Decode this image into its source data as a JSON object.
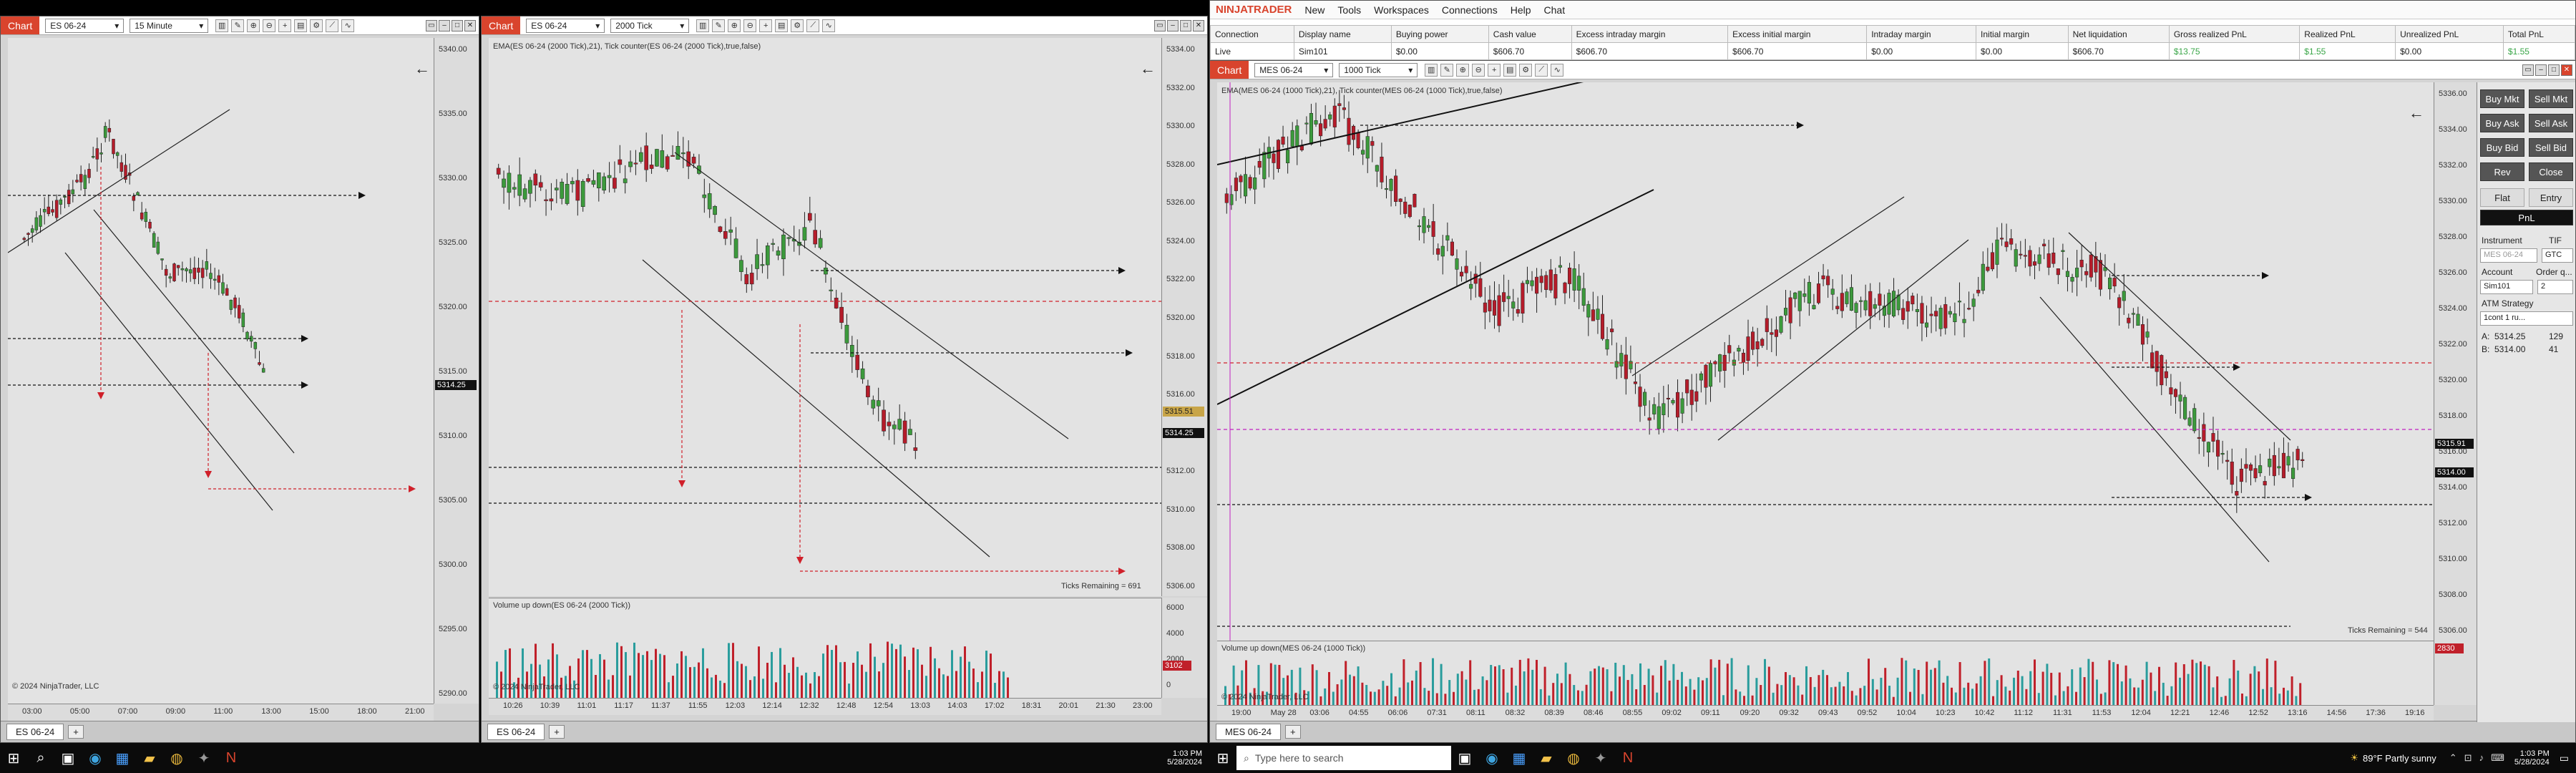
{
  "chart1": {
    "label": "Chart",
    "instrument": "ES 06-24",
    "period": "15 Minute",
    "y_ticks": [
      "5340.00",
      "5335.00",
      "5330.00",
      "5325.00",
      "5320.00",
      "5315.00",
      "5310.00",
      "5305.00",
      "5300.00",
      "5295.00",
      "5290.00"
    ],
    "x_ticks": [
      "03:00",
      "05:00",
      "07:00",
      "09:00",
      "11:00",
      "13:00",
      "15:00",
      "18:00",
      "21:00"
    ],
    "last_price": "5314.25",
    "copyright": "© 2024 NinjaTrader, LLC",
    "tab": "ES 06-24",
    "tab_add": "+",
    "back": "←"
  },
  "chart2": {
    "label": "Chart",
    "instrument": "ES 06-24",
    "period": "2000 Tick",
    "indicator": "EMA(ES 06-24 (2000 Tick),21), Tick counter(ES 06-24 (2000 Tick),true,false)",
    "y_ticks": [
      "5334.00",
      "5332.00",
      "5330.00",
      "5328.00",
      "5326.00",
      "5324.00",
      "5322.00",
      "5320.00",
      "5318.00",
      "5316.00",
      "5314.00",
      "5312.00",
      "5310.00",
      "5308.00",
      "5306.00"
    ],
    "x_ticks": [
      "10:26",
      "10:39",
      "11:01",
      "11:17",
      "11:37",
      "11:55",
      "12:03",
      "12:14",
      "12:32",
      "12:48",
      "12:54",
      "13:03",
      "14:03",
      "17:02",
      "18:31",
      "20:01",
      "21:30",
      "23:00"
    ],
    "price_badge_1": "5315.51",
    "price_badge_2": "5314.25",
    "ticks_remaining": "Ticks Remaining = 691",
    "volume_title": "Volume up down(ES 06-24 (2000 Tick))",
    "volume_ticks": [
      "6000",
      "4000",
      "2000",
      "0"
    ],
    "volume_badge": "3102",
    "copyright": "© 2024 NinjaTrader, LLC",
    "tab": "ES 06-24",
    "tab_add": "+",
    "back": "←"
  },
  "nt": {
    "brand": "NINJATRADER",
    "menu": [
      "New",
      "Tools",
      "Workspaces",
      "Connections",
      "Help",
      "Chat"
    ],
    "table_headers": [
      "Connection",
      "Display name",
      "Buying power",
      "Cash value",
      "Excess intraday margin",
      "Excess initial margin",
      "Intraday margin",
      "Initial margin",
      "Net liquidation",
      "Gross realized PnL",
      "Realized PnL",
      "Unrealized PnL",
      "Total PnL"
    ],
    "table_row": [
      "Live",
      "Sim101",
      "$0.00",
      "$606.70",
      "$606.70",
      "$606.70",
      "$0.00",
      "$0.00",
      "$606.70",
      "$13.75",
      "$1.55",
      "$0.00",
      "$1.55"
    ]
  },
  "chart3": {
    "label": "Chart",
    "instrument": "MES 06-24",
    "period": "1000 Tick",
    "indicator": "EMA(MES 06-24 (1000 Tick),21), Tick counter(MES 06-24 (1000 Tick),true,false)",
    "y_ticks": [
      "5336.00",
      "5334.00",
      "5332.00",
      "5330.00",
      "5328.00",
      "5326.00",
      "5324.00",
      "5322.00",
      "5320.00",
      "5318.00",
      "5316.00",
      "5314.00",
      "5312.00",
      "5310.00",
      "5308.00",
      "5306.00"
    ],
    "x_ticks": [
      "19:00",
      "May 28",
      "03:06",
      "04:55",
      "06:06",
      "07:31",
      "08:11",
      "08:32",
      "08:39",
      "08:46",
      "08:55",
      "09:02",
      "09:11",
      "09:20",
      "09:32",
      "09:43",
      "09:52",
      "10:04",
      "10:23",
      "10:42",
      "11:12",
      "11:31",
      "11:53",
      "12:04",
      "12:21",
      "12:46",
      "12:52",
      "13:16",
      "14:56",
      "17:36",
      "19:16"
    ],
    "price_badge_1": "5315.91",
    "price_badge_2": "5314.00",
    "ticks_remaining": "Ticks Remaining = 544",
    "volume_title": "Volume up down(MES 06-24 (1000 Tick))",
    "volume_badge": "2830",
    "copyright": "© 2024 NinjaTrader, LLC",
    "tab": "MES 06-24",
    "tab_add": "+",
    "back": "←"
  },
  "trade_panel": {
    "buy_mkt": "Buy Mkt",
    "sell_mkt": "Sell Mkt",
    "buy_ask": "Buy Ask",
    "sell_ask": "Sell Ask",
    "buy_bid": "Buy Bid",
    "sell_bid": "Sell Bid",
    "rev": "Rev",
    "close": "Close",
    "flat": "Flat",
    "entry": "Entry",
    "pnl": "PnL",
    "instrument_label": "Instrument",
    "tif_label": "TIF",
    "instrument_value": "MES 06-24",
    "tif_value": "GTC",
    "account_label": "Account",
    "order_qty_label": "Order q...",
    "account_value": "Sim101",
    "qty_value": "2",
    "atm_label": "ATM Strategy",
    "atm_value": "1cont 1 ru...",
    "ask_label": "A:",
    "ask_price": "5314.25",
    "ask_size": "129",
    "bid_label": "B:",
    "bid_price": "5314.00",
    "bid_size": "41"
  },
  "taskbar": {
    "search_placeholder": "Type here to search",
    "left_time": "1:03 PM",
    "left_date": "5/28/2024",
    "weather": "89°F  Partly sunny",
    "right_time": "1:03 PM",
    "right_date": "5/28/2024"
  },
  "colors": {
    "bull": "#3c9a3c",
    "bear": "#b51c2a",
    "chart_bg": "#e3e3e3",
    "brand_red": "#d9442d"
  }
}
